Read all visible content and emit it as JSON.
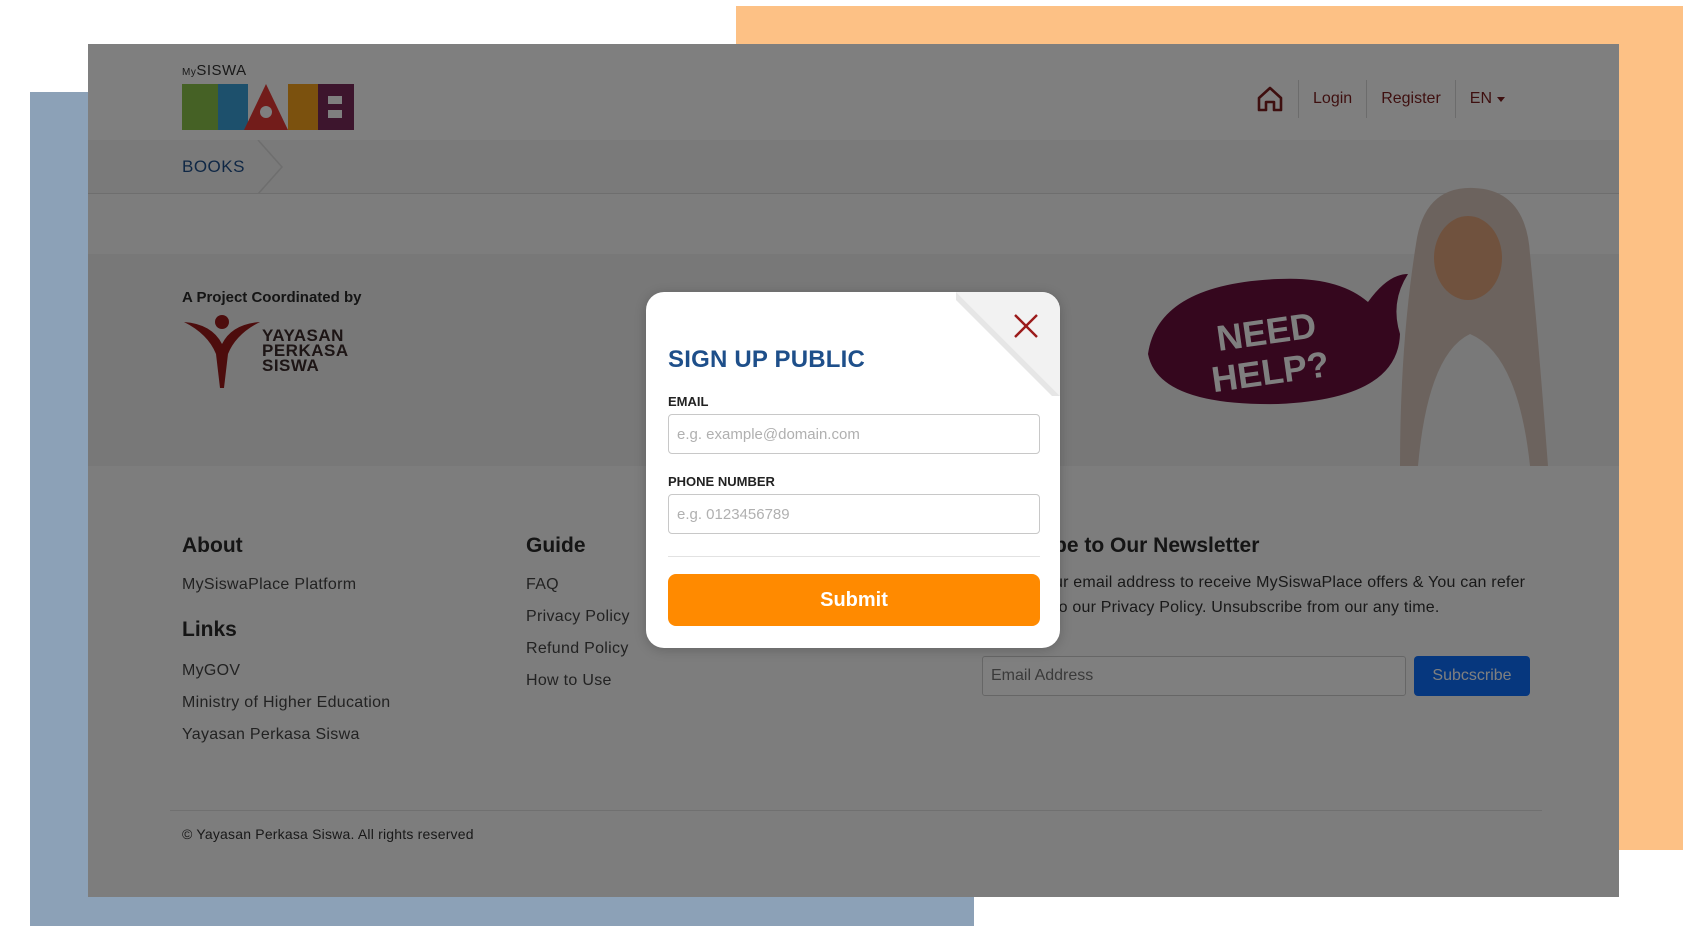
{
  "header": {
    "logo_small": "SISWA",
    "logo_small_prefix": "My",
    "nav": {
      "login": "Login",
      "register": "Register",
      "language": "EN"
    },
    "home_icon": "home-icon"
  },
  "breadcrumb": {
    "current": "BOOKS"
  },
  "coordinator": {
    "title": "A Project Coordinated by",
    "org_line1": "YAYASAN",
    "org_line2": "PERKASA",
    "org_line3": "SISWA"
  },
  "help_banner": {
    "line1": "NEED",
    "line2": "HELP?"
  },
  "footer": {
    "about": {
      "title": "About",
      "links": [
        "MySiswaPlace Platform"
      ]
    },
    "links": {
      "title": "Links",
      "links": [
        "MyGOV",
        "Ministry of Higher Education",
        "Yayasan Perkasa Siswa"
      ]
    },
    "guide": {
      "title": "Guide",
      "links": [
        "FAQ",
        "Privacy Policy",
        "Refund Policy",
        "How to Use"
      ]
    },
    "newsletter": {
      "title": "be to Our Newsletter",
      "text": "ur email address to receive MySiswaPlace offers & You can refer to our Privacy Policy. Unsubscribe from our any time.",
      "placeholder": "Email Address",
      "button": "Subcscribe"
    },
    "copyright": "© Yayasan Perkasa Siswa. All rights reserved"
  },
  "modal": {
    "title": "SIGN UP PUBLIC",
    "email_label": "EMAIL",
    "email_placeholder": "e.g. example@domain.com",
    "phone_label": "PHONE NUMBER",
    "phone_placeholder": "e.g. 0123456789",
    "submit": "Submit"
  },
  "colors": {
    "accent_orange": "#ff8a00",
    "title_blue": "#1e4f8a",
    "link_maroon": "#7d1e1e",
    "subscribe_blue": "#0d6efd"
  }
}
